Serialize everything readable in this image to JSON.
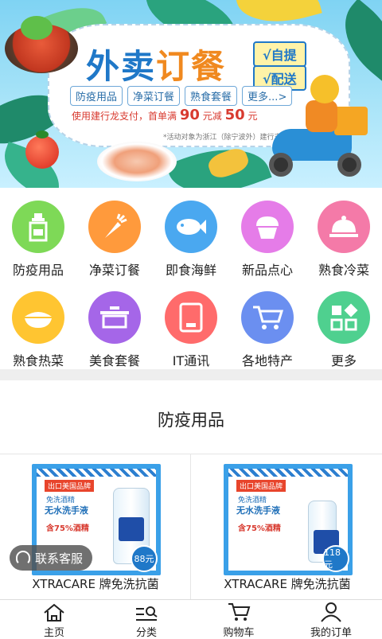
{
  "banner": {
    "title_part1": "外卖",
    "title_part2": "订餐",
    "pickup_label": "√自提",
    "delivery_label": "√配送",
    "tags": [
      "防疫用品",
      "净菜订餐",
      "熟食套餐",
      "更多...>"
    ],
    "promo_prefix": "使用建行龙支付，首单满",
    "promo_amount1": "90",
    "promo_mid": "元减",
    "promo_amount2": "50",
    "promo_suffix": "元",
    "note": "*活动对象为浙江（除宁波外）建行支付客户"
  },
  "categories": [
    {
      "label": "防疫用品",
      "icon": "sanitizer-icon",
      "color": "#7ed957"
    },
    {
      "label": "净菜订餐",
      "icon": "carrot-icon",
      "color": "#ff9a3c"
    },
    {
      "label": "即食海鲜",
      "icon": "fish-icon",
      "color": "#4aa8f0"
    },
    {
      "label": "新品点心",
      "icon": "cupcake-icon",
      "color": "#e57ce8"
    },
    {
      "label": "熟食冷菜",
      "icon": "cloche-icon",
      "color": "#f47aa8"
    },
    {
      "label": "熟食热菜",
      "icon": "hot-dish-icon",
      "color": "#ffc531"
    },
    {
      "label": "美食套餐",
      "icon": "pot-icon",
      "color": "#a566e8"
    },
    {
      "label": "IT通讯",
      "icon": "tablet-icon",
      "color": "#ff6b6b"
    },
    {
      "label": "各地特产",
      "icon": "cart-icon",
      "color": "#6b8ff0"
    },
    {
      "label": "更多",
      "icon": "grid-icon",
      "color": "#4fd08f"
    }
  ],
  "section": {
    "title": "防疫用品"
  },
  "products": [
    {
      "name": "XTRACARE 牌免洗抗菌",
      "price": "88元",
      "img_tag": "出口美国品牌",
      "img_line1": "免洗酒精",
      "img_line2": "无水洗手液",
      "img_line3": "含75%酒精"
    },
    {
      "name": "XTRACARE 牌免洗抗菌",
      "price": "118元",
      "img_tag": "出口美国品牌",
      "img_line1": "免洗酒精",
      "img_line2": "无水洗手液",
      "img_line3": "含75%酒精"
    }
  ],
  "customer_service": {
    "label": "联系客服"
  },
  "nav": [
    {
      "label": "主页",
      "icon": "home-icon"
    },
    {
      "label": "分类",
      "icon": "category-search-icon"
    },
    {
      "label": "购物车",
      "icon": "cart-icon"
    },
    {
      "label": "我的订单",
      "icon": "user-icon"
    }
  ]
}
